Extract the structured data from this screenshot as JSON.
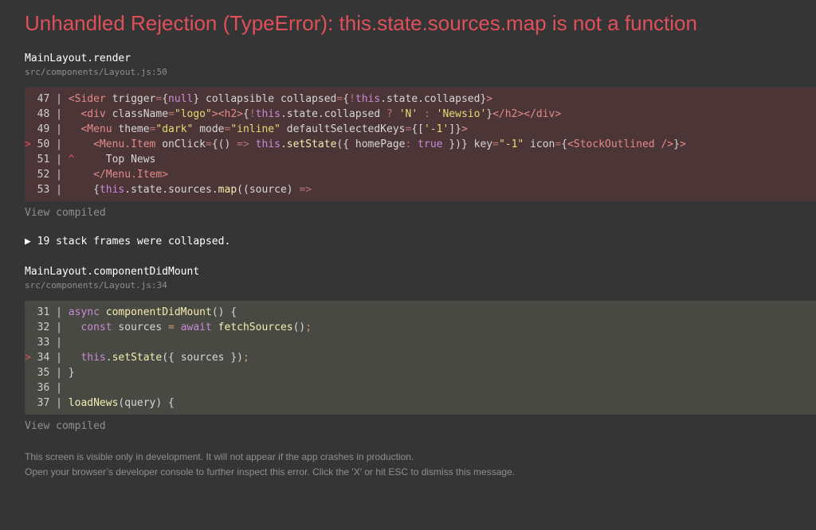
{
  "error": {
    "title": "Unhandled Rejection (TypeError): this.state.sources.map is not a function"
  },
  "frames": [
    {
      "function": "MainLayout.render",
      "file": "src/components/Layout.js:50",
      "view_compiled": "View compiled",
      "lines": [
        {
          "marker": "  ",
          "num": "47",
          "pipe": " | ",
          "code": "<Sider trigger={null} collapsible collapsed={!this.state.collapsed}>"
        },
        {
          "marker": "  ",
          "num": "48",
          "pipe": " | ",
          "code": "  <div className=\"logo\"><h2>{!this.state.collapsed ? 'N' : 'Newsio'}</h2></div>"
        },
        {
          "marker": "  ",
          "num": "49",
          "pipe": " | ",
          "code": "  <Menu theme=\"dark\" mode=\"inline\" defaultSelectedKeys={['-1']}>"
        },
        {
          "marker": "> ",
          "num": "50",
          "pipe": " | ",
          "code": "    <Menu.Item onClick={() => this.setState({ homePage: true })} key=\"-1\" icon={<StockOutlined />}>"
        },
        {
          "marker": "  ",
          "num": "51",
          "pipe": " | ",
          "code": "^     Top News"
        },
        {
          "marker": "  ",
          "num": "52",
          "pipe": " | ",
          "code": "    </Menu.Item>"
        },
        {
          "marker": "  ",
          "num": "53",
          "pipe": " | ",
          "code": "    {this.state.sources.map((source) =>"
        }
      ]
    },
    {
      "function": "MainLayout.componentDidMount",
      "file": "src/components/Layout.js:34",
      "view_compiled": "View compiled",
      "lines": [
        {
          "marker": "  ",
          "num": "31",
          "pipe": " | ",
          "code": "async componentDidMount() {"
        },
        {
          "marker": "  ",
          "num": "32",
          "pipe": " | ",
          "code": "  const sources = await fetchSources();"
        },
        {
          "marker": "  ",
          "num": "33",
          "pipe": " | ",
          "code": ""
        },
        {
          "marker": "> ",
          "num": "34",
          "pipe": " | ",
          "code": "  this.setState({ sources });"
        },
        {
          "marker": "  ",
          "num": "35",
          "pipe": " | ",
          "code": "}"
        },
        {
          "marker": "  ",
          "num": "36",
          "pipe": " | ",
          "code": ""
        },
        {
          "marker": "  ",
          "num": "37",
          "pipe": " | ",
          "code": "loadNews(query) {"
        }
      ]
    }
  ],
  "collapsed_frames": "▶ 19 stack frames were collapsed.",
  "footer": {
    "line1": "This screen is visible only in development. It will not appear if the app crashes in production.",
    "line2": "Open your browser’s developer console to further inspect this error.  Click the 'X' or hit ESC to dismiss this message."
  },
  "colors": {
    "title": "#e0505a",
    "background": "#353535",
    "highlight_red": "#4b3537",
    "highlight_green": "#484943"
  }
}
